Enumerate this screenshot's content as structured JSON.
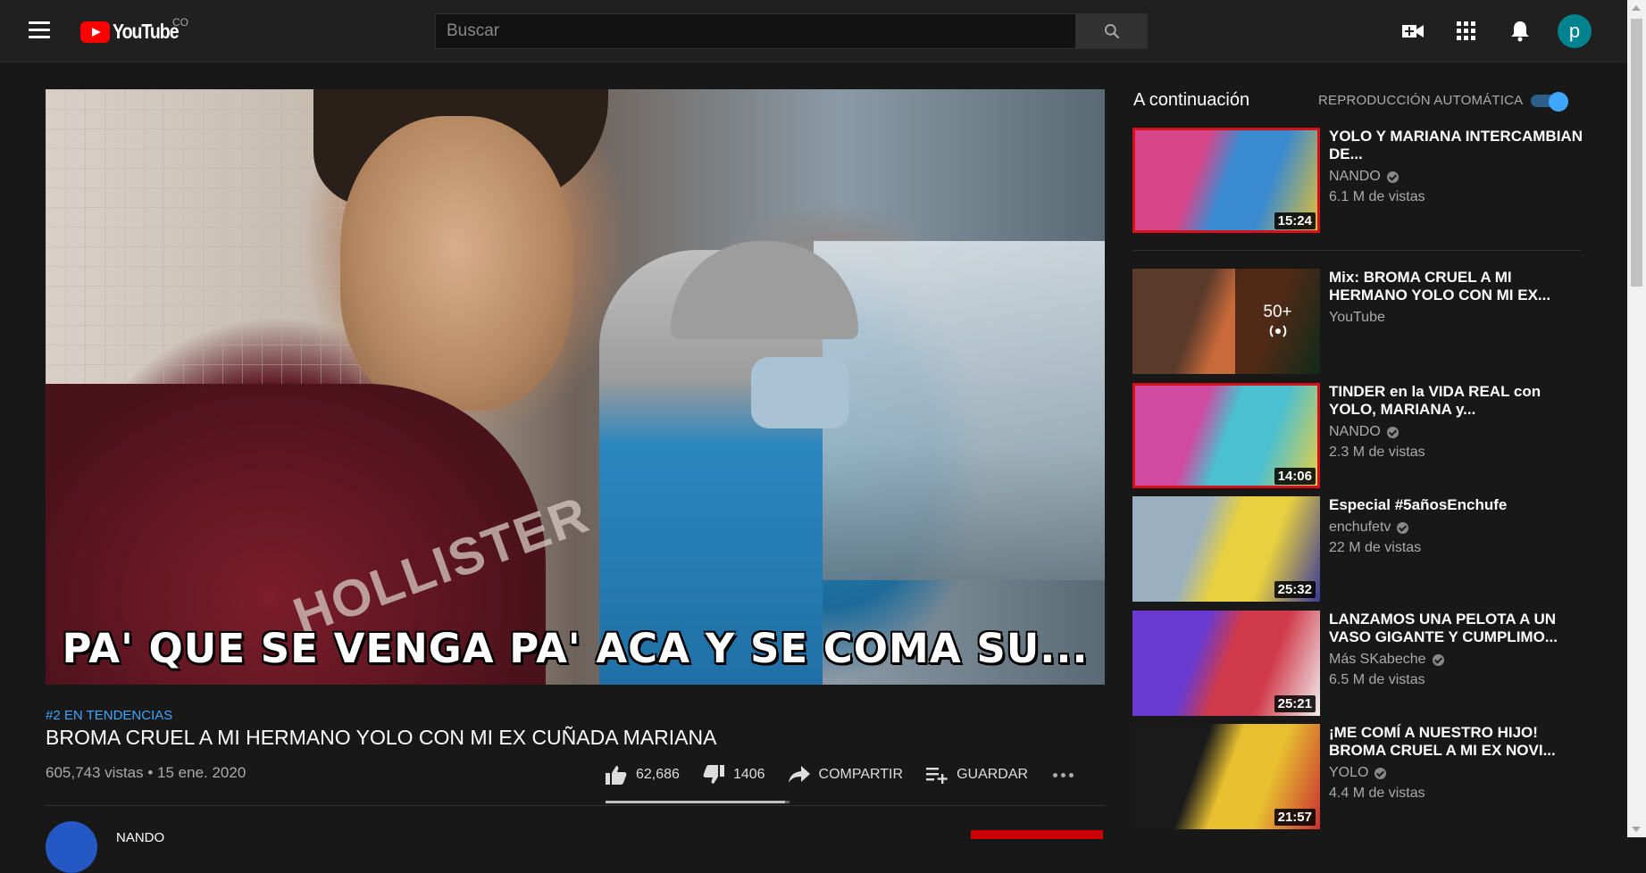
{
  "header": {
    "logo_text": "YouTube",
    "country_code": "CO",
    "search_placeholder": "Buscar",
    "avatar_letter": "p"
  },
  "video": {
    "subtitle_overlay": "PA' QUE SE VENGA PA' ACA Y SE COMA SU...",
    "shirt_text": "HOLLISTER",
    "trending": "#2 EN TENDENCIAS",
    "title": "BROMA CRUEL A MI HERMANO YOLO CON MI EX CUÑADA MARIANA",
    "views_date": "605,743 vistas • 15 ene. 2020",
    "likes": "62,686",
    "dislikes": "1406",
    "like_ratio": 0.978,
    "share_label": "COMPARTIR",
    "save_label": "GUARDAR",
    "channel_name": "NANDO"
  },
  "sidebar": {
    "up_next": "A continuación",
    "autoplay_label": "REPRODUCCIÓN AUTOMÁTICA",
    "autoplay_on": true,
    "items": [
      {
        "title": "YOLO Y MARIANA INTERCAMBIAN DE...",
        "channel": "NANDO",
        "verified": true,
        "views": "6.1 M de vistas",
        "duration": "15:24",
        "thumb_colors": [
          "#d8468a",
          "#3a8ad0",
          "#e8c230"
        ]
      },
      {
        "title": "Mix: BROMA CRUEL A MI HERMANO YOLO CON MI EX...",
        "channel": "YouTube",
        "verified": false,
        "views": "",
        "duration": "",
        "mix_count": "50+",
        "thumb_colors": [
          "#5a3a2a",
          "#c86a3a",
          "#2a6a3a"
        ]
      },
      {
        "title": "TINDER en la VIDA REAL con YOLO, MARIANA y...",
        "channel": "NANDO",
        "verified": true,
        "views": "2.3 M de vistas",
        "duration": "14:06",
        "thumb_colors": [
          "#d04aa0",
          "#4ac0d0",
          "#f0d040"
        ]
      },
      {
        "title": "Especial #5añosEnchufe",
        "channel": "enchufetv",
        "verified": true,
        "views": "22 M de vistas",
        "duration": "25:32",
        "thumb_colors": [
          "#9ab0c0",
          "#e8d040",
          "#3a3a9a"
        ]
      },
      {
        "title": "LANZAMOS UNA PELOTA A UN VASO GIGANTE Y CUMPLIMO...",
        "channel": "Más SKabeche",
        "verified": true,
        "views": "6.5 M de vistas",
        "duration": "25:21",
        "thumb_colors": [
          "#6a3ad0",
          "#d03a4a",
          "#f0f0f0"
        ]
      },
      {
        "title": "¡ME COMÍ A NUESTRO HIJO! BROMA CRUEL A MI EX NOVI...",
        "channel": "YOLO",
        "verified": true,
        "views": "4.4 M de vistas",
        "duration": "21:57",
        "thumb_colors": [
          "#1a1a1a",
          "#e8c030",
          "#c83030"
        ]
      }
    ]
  }
}
